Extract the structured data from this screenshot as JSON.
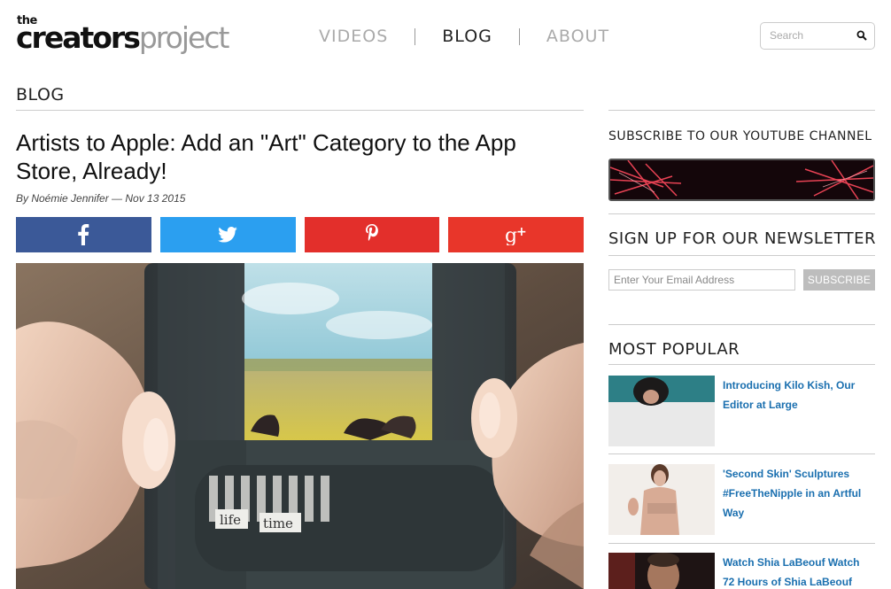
{
  "header": {
    "logo_the": "the",
    "logo_word_a": "creators",
    "logo_word_b": "project",
    "nav": [
      "VIDEOS",
      "BLOG",
      "ABOUT"
    ],
    "search_placeholder": "Search"
  },
  "main": {
    "section_title": "BLOG",
    "article_title": "Artists to Apple: Add an \"Art\" Category to the App Store, Already!",
    "byline": "By Noémie Jennifer — Nov 13 2015",
    "share": [
      {
        "network": "facebook",
        "icon": "facebook-icon",
        "color": "#3b5998"
      },
      {
        "network": "twitter",
        "icon": "twitter-icon",
        "color": "#2b9ff0"
      },
      {
        "network": "pinterest",
        "icon": "pinterest-icon",
        "color": "#e32f2b"
      },
      {
        "network": "google-plus",
        "icon": "google-plus-icon",
        "color": "#e8362a"
      }
    ],
    "hero_words": [
      "life",
      "time"
    ]
  },
  "sidebar": {
    "youtube_heading": "SUBSCRIBE TO OUR YOUTUBE CHANNEL",
    "newsletter_heading": "SIGN UP FOR OUR NEWSLETTER",
    "email_placeholder": "Enter Your Email Address",
    "subscribe_label": "SUBSCRIBE",
    "popular_heading": "MOST POPULAR",
    "popular": [
      {
        "title": "Introducing Kilo Kish, Our Editor at Large"
      },
      {
        "title": "'Second Skin' Sculptures #FreeTheNipple in an Artful Way"
      },
      {
        "title": "Watch Shia LaBeouf Watch 72 Hours of Shia LaBeouf"
      }
    ]
  },
  "colors": {
    "link": "#1a6faf",
    "facebook": "#3b5998",
    "twitter": "#2b9ff0",
    "pinterest": "#e32f2b",
    "google_plus": "#e8362a",
    "subscribe_button": "#bdbdbd"
  }
}
